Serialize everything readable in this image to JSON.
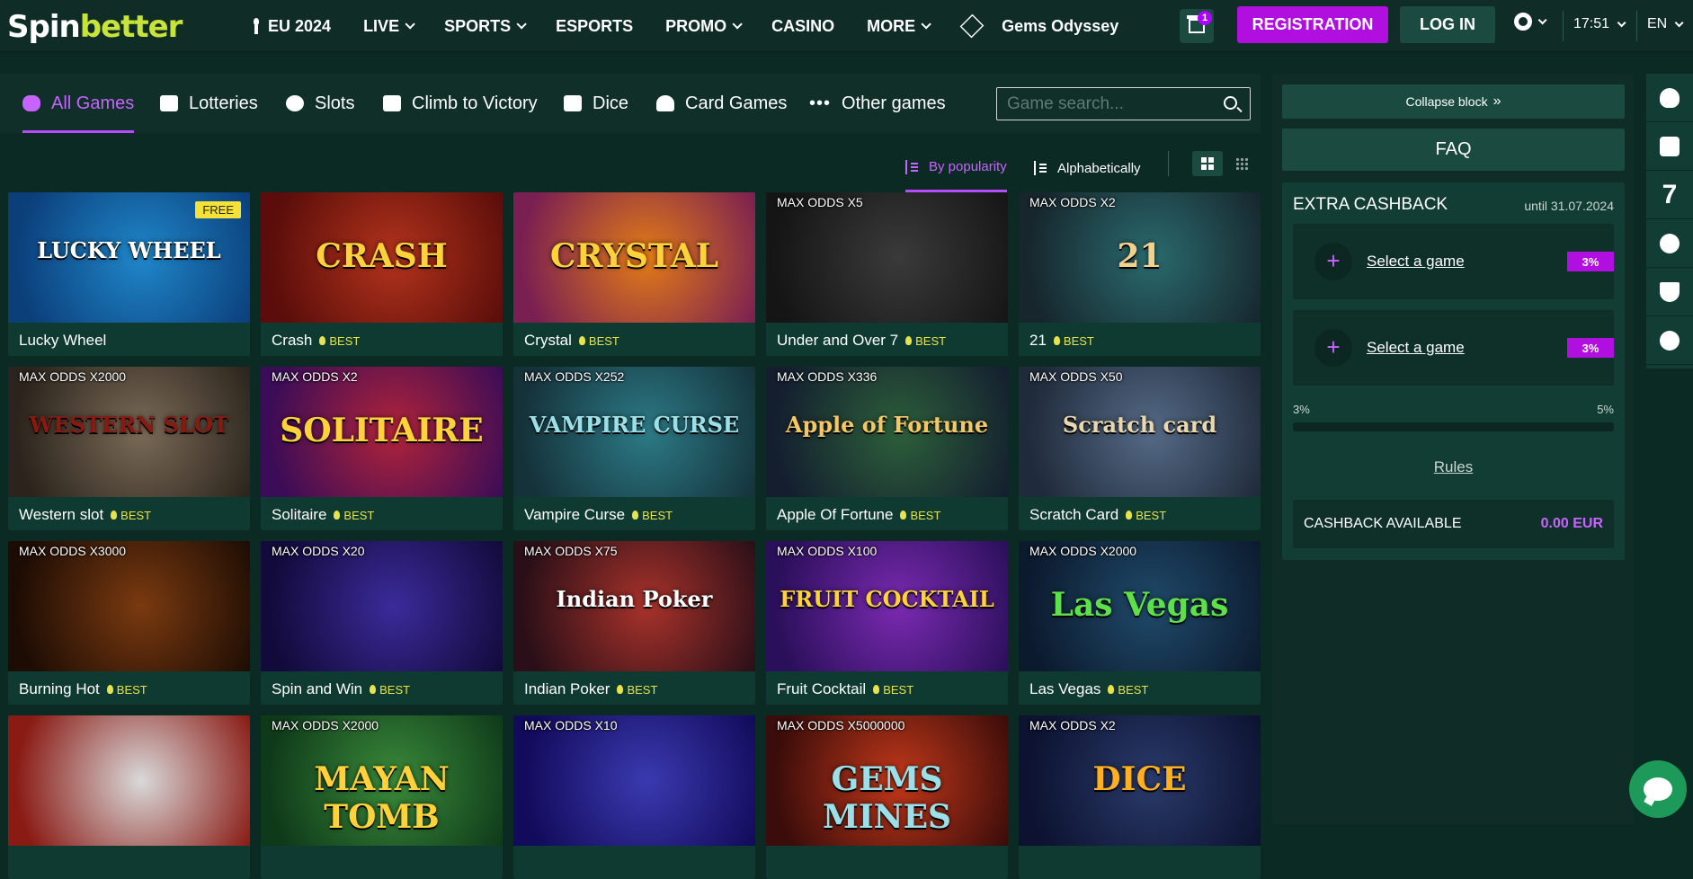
{
  "brand": {
    "part1": "Spin",
    "part2": "better"
  },
  "nav": [
    {
      "label": "EU 2024",
      "icon": "torch-icon",
      "dropdown": false
    },
    {
      "label": "LIVE",
      "dropdown": true
    },
    {
      "label": "SPORTS",
      "dropdown": true
    },
    {
      "label": "ESPORTS",
      "dropdown": false
    },
    {
      "label": "PROMO",
      "dropdown": true
    },
    {
      "label": "CASINO",
      "dropdown": false
    },
    {
      "label": "MORE",
      "dropdown": true
    },
    {
      "label": "Gems Odyssey",
      "icon": "gem-icon",
      "dropdown": false
    }
  ],
  "header": {
    "gift_badge": "1",
    "registration": "REGISTRATION",
    "login": "LOG IN",
    "time": "17:51",
    "lang": "EN"
  },
  "categories": [
    {
      "label": "All Games",
      "icon": "gamepad-icon",
      "active": true
    },
    {
      "label": "Lotteries",
      "icon": "ticket-icon",
      "active": false
    },
    {
      "label": "Slots",
      "icon": "cherries-icon",
      "active": false
    },
    {
      "label": "Climb to Victory",
      "icon": "stairs-icon",
      "active": false
    },
    {
      "label": "Dice",
      "icon": "dice-icon",
      "active": false
    },
    {
      "label": "Card Games",
      "icon": "spade-icon",
      "active": false
    },
    {
      "label": "Other games",
      "icon": "dots-icon",
      "active": false
    }
  ],
  "search": {
    "placeholder": "Game search..."
  },
  "sort": {
    "popularity": "By popularity",
    "alpha": "Alphabetically"
  },
  "games": [
    {
      "title": "Lucky Wheel",
      "best": "",
      "odds": "",
      "free": "FREE",
      "art": "LUCKY WHEEL",
      "colors": [
        "#1f86c9",
        "#0b3f7a"
      ],
      "artColor": "#ffffff"
    },
    {
      "title": "Crash",
      "best": "BEST",
      "odds": "",
      "free": "",
      "art": "CRASH",
      "colors": [
        "#b2331c",
        "#5a0d0a"
      ],
      "artColor": "#ffd23a"
    },
    {
      "title": "Crystal",
      "best": "BEST",
      "odds": "",
      "free": "",
      "art": "CRYSTAL",
      "colors": [
        "#e27b17",
        "#7a1f52"
      ],
      "artColor": "#ffd23a"
    },
    {
      "title": "Under and Over 7",
      "best": "BEST",
      "odds": "MAX ODDS X5",
      "free": "",
      "art": "",
      "colors": [
        "#3a3a3a",
        "#151515"
      ],
      "artColor": "#ffffff"
    },
    {
      "title": "21",
      "best": "BEST",
      "odds": "MAX ODDS X2",
      "free": "",
      "art": "21",
      "colors": [
        "#2a6a6e",
        "#16262c"
      ],
      "artColor": "#f2d28a"
    },
    {
      "title": "Western slot",
      "best": "BEST",
      "odds": "MAX ODDS X2000",
      "free": "",
      "art": "WESTERN SLOT",
      "colors": [
        "#7a6a57",
        "#2b241c"
      ],
      "artColor": "#8a1a10"
    },
    {
      "title": "Solitaire",
      "best": "BEST",
      "odds": "MAX ODDS X2",
      "free": "",
      "art": "SOLITAIRE",
      "colors": [
        "#b0233a",
        "#3b0c57"
      ],
      "artColor": "#ffd23a"
    },
    {
      "title": "Vampire Curse",
      "best": "BEST",
      "odds": "MAX ODDS X252",
      "free": "",
      "art": "VAMPIRE CURSE",
      "colors": [
        "#2c7a86",
        "#15323a"
      ],
      "artColor": "#9be0e8"
    },
    {
      "title": "Apple Of Fortune",
      "best": "BEST",
      "odds": "MAX ODDS X336",
      "free": "",
      "art": "Apple of Fortune",
      "colors": [
        "#2c5f3a",
        "#141e2f"
      ],
      "artColor": "#f3c766"
    },
    {
      "title": "Scratch Card",
      "best": "BEST",
      "odds": "MAX ODDS X50",
      "free": "",
      "art": "Scratch card",
      "colors": [
        "#556a86",
        "#1f2a3a"
      ],
      "artColor": "#e9d7b0"
    },
    {
      "title": "Burning Hot",
      "best": "BEST",
      "odds": "MAX ODDS X3000",
      "free": "",
      "art": "",
      "colors": [
        "#7a3a10",
        "#1d0c04"
      ],
      "artColor": "#ffd23a"
    },
    {
      "title": "Spin and Win",
      "best": "BEST",
      "odds": "MAX ODDS X20",
      "free": "",
      "art": "",
      "colors": [
        "#3b2a9a",
        "#120a3a"
      ],
      "artColor": "#ffd23a"
    },
    {
      "title": "Indian Poker",
      "best": "BEST",
      "odds": "MAX ODDS X75",
      "free": "",
      "art": "Indian Poker",
      "colors": [
        "#a8322a",
        "#2a0f18"
      ],
      "artColor": "#ffffff"
    },
    {
      "title": "Fruit Cocktail",
      "best": "BEST",
      "odds": "MAX ODDS X100",
      "free": "",
      "art": "FRUIT COCKTAIL",
      "colors": [
        "#7a2ab0",
        "#2a0f5a"
      ],
      "artColor": "#ffd23a"
    },
    {
      "title": "Las Vegas",
      "best": "BEST",
      "odds": "MAX ODDS X2000",
      "free": "",
      "art": "Las Vegas",
      "colors": [
        "#1f4a6a",
        "#0c1a2e"
      ],
      "artColor": "#5de04a"
    },
    {
      "title": "",
      "best": "",
      "odds": "",
      "free": "",
      "art": "",
      "colors": [
        "#d9d9d9",
        "#8a1a14"
      ],
      "artColor": "#ffffff"
    },
    {
      "title": "",
      "best": "",
      "odds": "MAX ODDS X2000",
      "free": "",
      "art": "MAYAN TOMB",
      "colors": [
        "#3a8a3a",
        "#0f3a1a"
      ],
      "artColor": "#ffd23a"
    },
    {
      "title": "",
      "best": "",
      "odds": "MAX ODDS X10",
      "free": "",
      "art": "",
      "colors": [
        "#3a3ab0",
        "#120a5a"
      ],
      "artColor": "#ffffff"
    },
    {
      "title": "",
      "best": "",
      "odds": "MAX ODDS X5000000",
      "free": "",
      "art": "GEMS MINES",
      "colors": [
        "#c2381a",
        "#3a0c0a"
      ],
      "artColor": "#9be0e8"
    },
    {
      "title": "",
      "best": "",
      "odds": "MAX ODDS X2",
      "free": "",
      "art": "DICE",
      "colors": [
        "#2a3a6a",
        "#0c1230"
      ],
      "artColor": "#ffb020"
    }
  ],
  "panel": {
    "collapse": "Collapse block",
    "faq": "FAQ",
    "cashback_title": "EXTRA CASHBACK",
    "cashback_until": "until 31.07.2024",
    "slots": [
      {
        "label": "Select a game",
        "pct": "3%"
      },
      {
        "label": "Select a game",
        "pct": "3%"
      }
    ],
    "range_min": "3%",
    "range_max": "5%",
    "progress": 0,
    "rules": "Rules",
    "available_label": "CASHBACK AVAILABLE",
    "available_value": "0.00 EUR"
  },
  "side_tools": [
    {
      "icon": "bug-icon"
    },
    {
      "icon": "gift-icon"
    },
    {
      "icon": "seven-icon",
      "text": "7"
    },
    {
      "icon": "poker-chip-icon"
    },
    {
      "icon": "trophy-icon"
    },
    {
      "icon": "dollar-icon"
    }
  ]
}
